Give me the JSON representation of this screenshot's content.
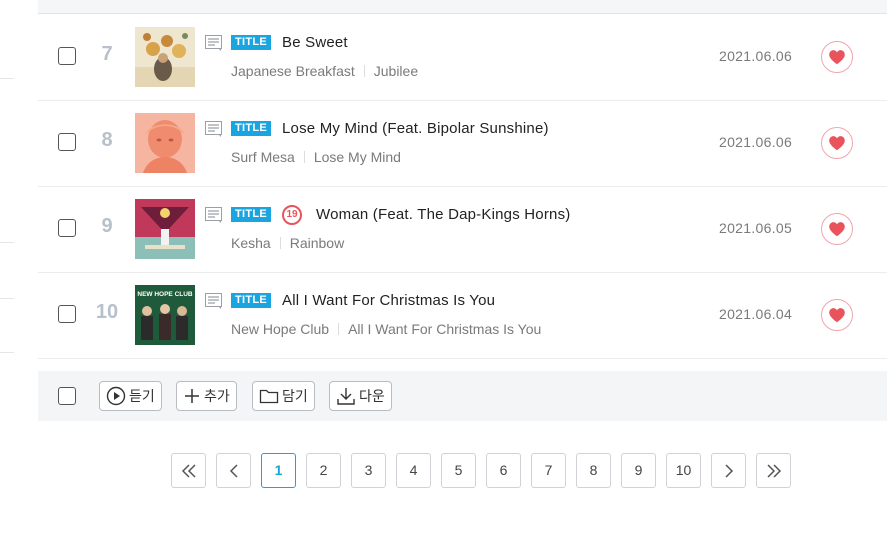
{
  "songs": [
    {
      "rank": "7",
      "title": "Be Sweet",
      "artist": "Japanese Breakfast",
      "album": "Jubilee",
      "date": "2021.06.06",
      "badge": "TITLE",
      "age": ""
    },
    {
      "rank": "8",
      "title": "Lose My Mind (Feat. Bipolar Sunshine)",
      "artist": "Surf Mesa",
      "album": "Lose My Mind",
      "date": "2021.06.06",
      "badge": "TITLE",
      "age": ""
    },
    {
      "rank": "9",
      "title": "Woman (Feat. The Dap-Kings Horns)",
      "artist": "Kesha",
      "album": "Rainbow",
      "date": "2021.06.05",
      "badge": "TITLE",
      "age": "19"
    },
    {
      "rank": "10",
      "title": "All I Want For Christmas Is You",
      "artist": "New Hope Club",
      "album": "All I Want For Christmas Is You",
      "date": "2021.06.04",
      "badge": "TITLE",
      "age": ""
    }
  ],
  "cover_text": {
    "new_hope_club": "NEW HOPE CLUB"
  },
  "actions": {
    "play": "듣기",
    "add": "추가",
    "save": "담기",
    "download": "다운"
  },
  "pagination": {
    "pages": [
      "1",
      "2",
      "3",
      "4",
      "5",
      "6",
      "7",
      "8",
      "9",
      "10"
    ],
    "current": "1"
  },
  "colors": {
    "accent": "#1aa5e0",
    "heart": "#e9545c",
    "rank": "#b7c0cb"
  },
  "icons": {
    "lyrics": "lyrics-icon",
    "like": "heart-icon",
    "play": "play-circle-icon",
    "add": "plus-icon",
    "save": "folder-icon",
    "download": "download-icon",
    "first": "double-chevron-left-icon",
    "prev": "chevron-left-icon",
    "next": "chevron-right-icon",
    "last": "double-chevron-right-icon"
  }
}
